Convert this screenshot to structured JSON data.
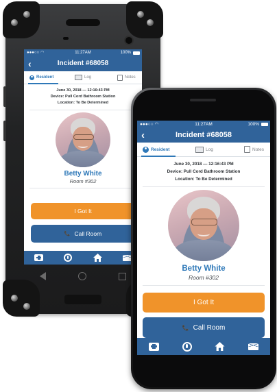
{
  "status_bar": {
    "signal": "●●●○○",
    "time": "11:27AM",
    "battery": "100%"
  },
  "header": {
    "back_glyph": "‹",
    "title": "Incident #68058"
  },
  "tabs": [
    {
      "label": "Resident",
      "icon": "person-circle-icon",
      "active": true
    },
    {
      "label": "Log",
      "icon": "keyboard-icon",
      "active": false
    },
    {
      "label": "Notes",
      "icon": "notes-icon",
      "active": false
    }
  ],
  "incident": {
    "datetime": "June 30, 2018 — 12:16:43 PM",
    "device": "Device: Pull Cord Bathroom Station",
    "location": "Location: To Be Determined"
  },
  "resident": {
    "name": "Betty White",
    "room": "Room #302"
  },
  "actions": {
    "got_it": "I Got It",
    "call_room": "Call Room",
    "phone_glyph": "📞"
  },
  "bottom_nav": [
    "medical-kit-icon",
    "accessibility-icon",
    "home-icon",
    "mail-icon"
  ],
  "colors": {
    "primary": "#30639a",
    "accent_orange": "#f0932a",
    "link_blue": "#2e78b8"
  }
}
